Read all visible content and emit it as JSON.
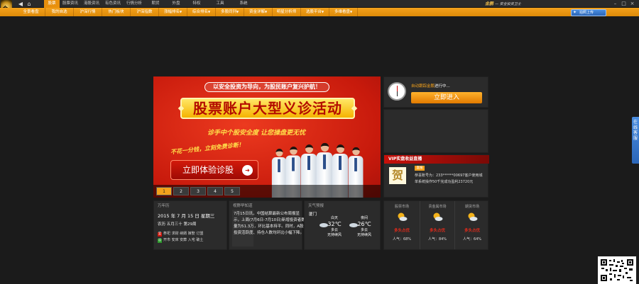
{
  "logo": {
    "text": "金"
  },
  "menu": {
    "items": [
      {
        "label": "股票",
        "active": true
      },
      {
        "label": "股票资讯"
      },
      {
        "label": "港股资讯"
      },
      {
        "label": "有色资讯"
      },
      {
        "label": "行情分析"
      },
      {
        "label": "期货"
      },
      {
        "label": "外盘"
      },
      {
        "label": "特权"
      },
      {
        "label": "工具"
      },
      {
        "label": "系统"
      }
    ]
  },
  "brand": {
    "name": "金鹏",
    "slogan": "— 安全投资卫士"
  },
  "subtabs": [
    {
      "label": "全景看盘"
    },
    {
      "label": "我的自选"
    },
    {
      "label": "沪深行情"
    },
    {
      "label": "热门板块"
    },
    {
      "label": "沪深指数"
    },
    {
      "label": "涨幅排名",
      "arrow": "▼"
    },
    {
      "label": "综合排名",
      "arrow": "▼"
    },
    {
      "label": "多股同列",
      "arrow": "▼"
    },
    {
      "label": "资金详解",
      "arrow": "▼"
    },
    {
      "label": "明星分析师"
    },
    {
      "label": "选股平台",
      "arrow": "▼"
    },
    {
      "label": "多维看盘",
      "arrow": "▼"
    }
  ],
  "upload": {
    "label": "拍照上传"
  },
  "banner": {
    "header": "以安全投资为导向，为股民账户复兴护航！",
    "title": "股票账户大型义诊活动",
    "subtitle": "诊手中个股安全度  让您操盘更无忧",
    "free_line": "不花一分钱，立刻免费诊断！",
    "cta": "立即体验诊股",
    "slides": [
      "1",
      "2",
      "3",
      "4",
      "5"
    ],
    "active_slide": 1
  },
  "auto_card": {
    "highlight": "自动跟踪金鹏",
    "suffix": "进行中...",
    "button": "立即进入"
  },
  "vip": {
    "header": "VIP实盘收益直播",
    "image_text": "贺",
    "tag": "喜报",
    "line1": "恭喜账号为：233******00697客户使用城",
    "line2": "单系统操作50千完成功盈利23720元"
  },
  "calendar": {
    "title": "万年历",
    "date": "2015 年 7 月 15 日 星期三",
    "lunar": "农历 五月三十 第29周",
    "ji_label": "宜",
    "ji": "祭祀 求财 纳婿 嫁娶 订盟",
    "yi_label": "忌",
    "yi": "开市 安床 安葬 入宅 破土"
  },
  "news": {
    "title": "视野早知道",
    "text": "7月15日讯，中国结算最新公布周报显示，上周(7月6日-7月10日)新增投资者数量为51.3万，环比基本持平。同时，A股投资活跃度、持仓人数均环比小幅下降。"
  },
  "weather": {
    "title": "天气预报",
    "city": "厦门",
    "today": {
      "label": "白天",
      "temp": "32℃",
      "desc": "多云",
      "wind": "无持续风"
    },
    "tonight": {
      "label": "夜间",
      "temp": "26℃",
      "desc": "多云",
      "wind": "无持续风"
    }
  },
  "markets": [
    {
      "name": "股票市场",
      "tip": "多头占优",
      "popularity": "人气：68%"
    },
    {
      "name": "贵金属市场",
      "tip": "多头占优",
      "popularity": "人气：84%"
    },
    {
      "name": "期货市场",
      "tip": "多头占优",
      "popularity": "人气：64%"
    }
  ],
  "side_tab": {
    "label": "在线客服"
  },
  "colors": {
    "accent": "#f3a11c",
    "banner_red": "#c81a0c",
    "bull_red": "#e02a1a"
  }
}
